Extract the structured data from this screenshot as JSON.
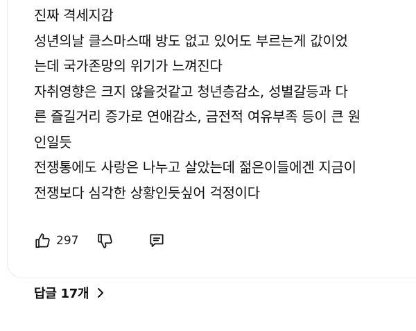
{
  "comment": {
    "lines": [
      "진짜 격세지감",
      "성년의날 클스마스때 방도 없고 있어도 부르는게 값이었",
      "는데 국가존망의 위기가 느껴진다",
      "자취영향은 크지 않을것같고 청년층감소, 성별갈등과 다",
      "른 즐길거리 증가로 연애감소, 금전적 여유부족 등이 큰 원",
      "인일듯",
      "전쟁통에도 사랑은 나누고 살았는데 젊은이들에겐 지금이",
      "전쟁보다 심각한 상황인듯싶어 걱정이다"
    ]
  },
  "actions": {
    "like_icon": "thumbs-up-icon",
    "like_count": "297",
    "dislike_icon": "thumbs-down-icon",
    "reply_icon": "comment-icon"
  },
  "replies": {
    "label": "답글 17개",
    "chevron_icon": "chevron-right-icon"
  }
}
